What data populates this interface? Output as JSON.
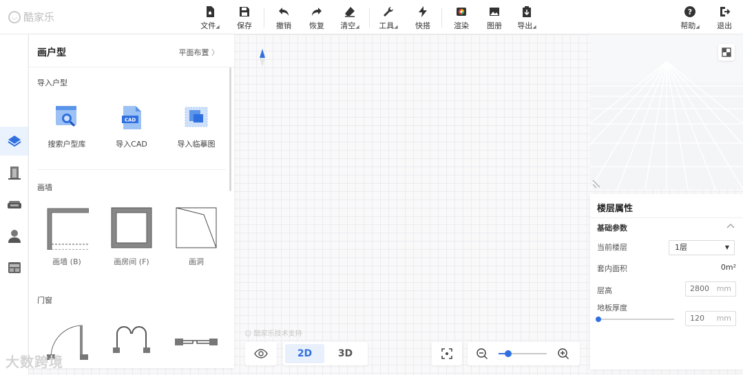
{
  "brand": {
    "name": "酷家乐"
  },
  "toolbar": {
    "file": "文件",
    "save": "保存",
    "undo": "撤销",
    "redo": "恢复",
    "clear": "清空",
    "tools": "工具",
    "shortcut": "快搭",
    "render": "渲染",
    "album": "图册",
    "export": "导出",
    "help": "帮助",
    "logout": "退出"
  },
  "panel": {
    "title": "画户型",
    "link": "平面布置",
    "import_section": "导入户型",
    "import_tiles": [
      "搜索户型库",
      "导入CAD",
      "导入临摹图"
    ],
    "cad_badge": "CAD",
    "wall_section": "画墙",
    "wall_tiles": [
      "画墙 (B)",
      "画房间 (F)",
      "画洞"
    ],
    "door_section": "门窗"
  },
  "canvas": {
    "watermark": "酷家乐技术支持",
    "overlay_text": "大数跨境"
  },
  "view_toggle": {
    "options": [
      "2D",
      "3D"
    ],
    "selected": "2D"
  },
  "zoom": {
    "level": 0.2
  },
  "floor_props": {
    "title": "楼层属性",
    "section": "基础参数",
    "current_floor_label": "当前楼层",
    "current_floor_value": "1层",
    "area_label": "套内面积",
    "area_value": "0m²",
    "height_label": "层高",
    "height_value": "2800",
    "height_unit": "mm",
    "slab_label": "地板厚度",
    "slab_value": "120",
    "slab_unit": "mm",
    "slab_slider_level": 0
  },
  "colors": {
    "accent": "#2f6fe0",
    "active_bg": "#eaf2fd"
  }
}
